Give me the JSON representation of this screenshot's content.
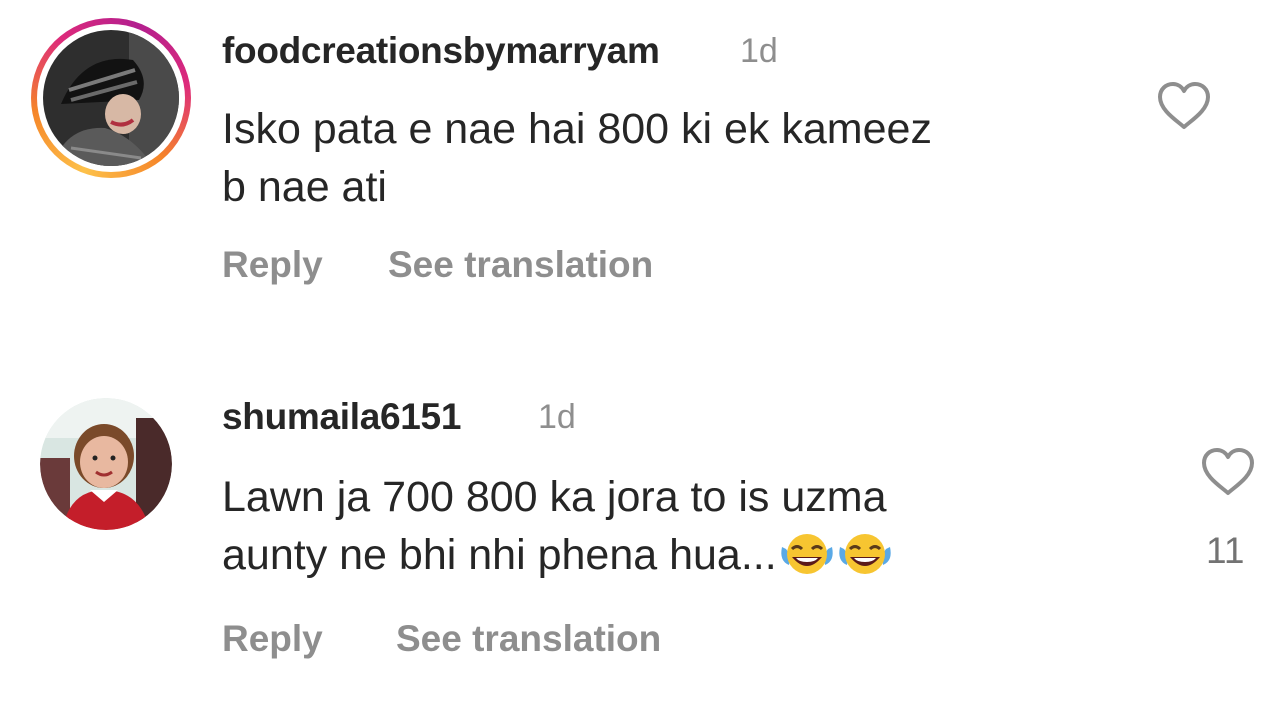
{
  "comments": [
    {
      "username": "foodcreationsbymarryam",
      "time": "1d",
      "text": "Isko pata e nae hai 800 ki ek kameez\nb nae ati",
      "reply_label": "Reply",
      "translate_label": "See translation",
      "likes": "",
      "avatar_has_story_ring": true
    },
    {
      "username": "shumaila6151",
      "time": "1d",
      "text": "Lawn ja 700 800 ka jora to is uzma\naunty ne bhi nhi phena hua...",
      "emojis": [
        "face-with-tears-of-joy",
        "face-with-tears-of-joy"
      ],
      "reply_label": "Reply",
      "translate_label": "See translation",
      "likes": "11",
      "avatar_has_story_ring": false
    }
  ],
  "colors": {
    "text_primary": "#262626",
    "text_secondary": "#8e8e8e",
    "heart_stroke": "#8e8e8e"
  }
}
